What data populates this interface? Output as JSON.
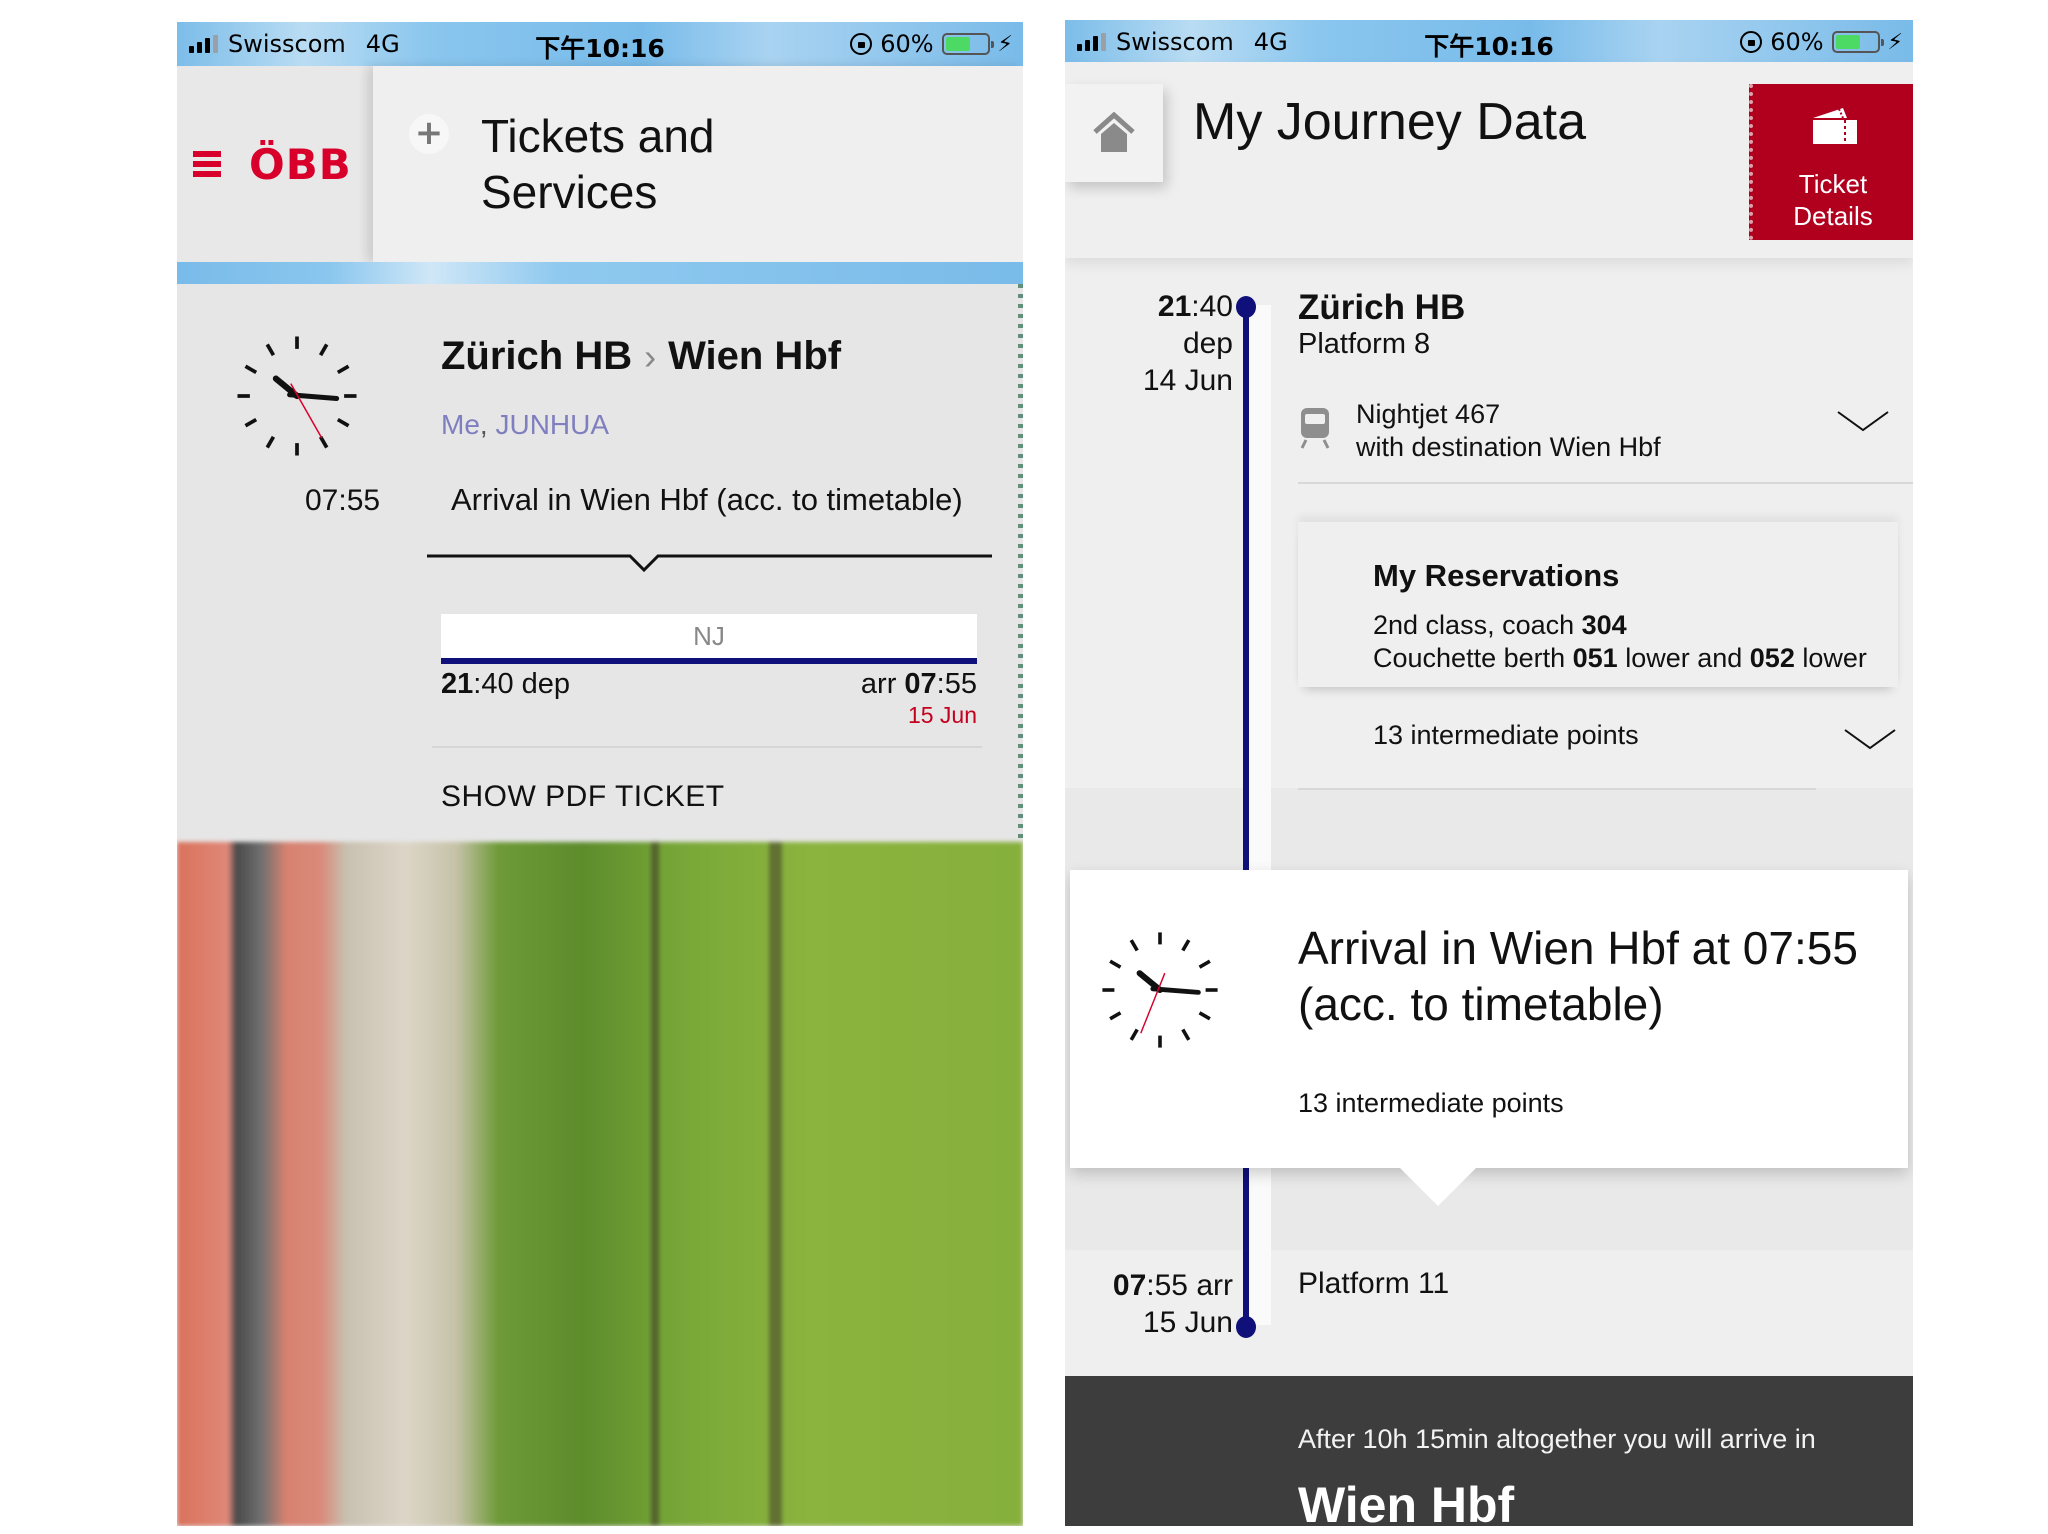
{
  "status_bar": {
    "carrier": "Swisscom",
    "network": "4G",
    "time": "下午10:16",
    "battery_text": "60%",
    "battery_level": 0.6,
    "icons": [
      "signal-icon",
      "orientation-lock-icon",
      "battery-icon",
      "charging-bolt-icon"
    ]
  },
  "left_screen": {
    "header": {
      "menu_icon": "hamburger-icon",
      "logo": "ÖBB",
      "add_icon": "plus-icon",
      "title_line1": "Tickets and",
      "title_line2": "Services"
    },
    "ticket_card": {
      "clock_time": "07:55",
      "origin": "Zürich HB",
      "destination": "Wien Hbf",
      "route_separator": "›",
      "passenger_me": "Me",
      "passenger_sep": ",",
      "passenger_name": "JUNHUA",
      "arrival_label": "Arrival in Wien Hbf (acc. to timetable)",
      "train_code": "NJ",
      "dep_hour": "21",
      "dep_rest": ":40 dep",
      "arr_prefix": "arr ",
      "arr_hour": "07",
      "arr_rest": ":55",
      "arr_date": "15 Jun",
      "pdf_button": "SHOW PDF TICKET"
    }
  },
  "right_screen": {
    "header": {
      "home_icon": "home-icon",
      "title": "My Journey Data",
      "ticket_details_line1": "Ticket",
      "ticket_details_line2": "Details"
    },
    "departure": {
      "hour": "21",
      "rest": ":40",
      "label": "dep",
      "date": "14 Jun",
      "station": "Zürich HB",
      "platform": "Platform 8"
    },
    "train": {
      "name": "Nightjet 467",
      "destination": "with destination Wien Hbf"
    },
    "reservations": {
      "title": "My Reservations",
      "class_text": "2nd class, coach ",
      "coach": "304",
      "berth_prefix": "Couchette berth ",
      "berth1": "051",
      "berth_mid": " lower and ",
      "berth2": "052",
      "berth_suffix": " lower"
    },
    "intermediate_points": "13 intermediate points",
    "arrival_card": {
      "title_line1": "Arrival in Wien Hbf at 07:55",
      "title_line2": "(acc. to timetable)",
      "intermediate_points": "13 intermediate points"
    },
    "arrival": {
      "hour": "07",
      "rest": ":55 arr",
      "date": "15 Jun",
      "platform": "Platform 11"
    },
    "summary": {
      "text": "After 10h 15min altogether you will arrive in",
      "destination": "Wien Hbf"
    }
  },
  "colors": {
    "obb_red": "#d8002a",
    "ticket_red": "#b0001e",
    "timeline_navy": "#10107a",
    "passenger_purple": "#7f7fbf",
    "date_red": "#c4001e",
    "summary_dark": "#3d3d3d"
  }
}
